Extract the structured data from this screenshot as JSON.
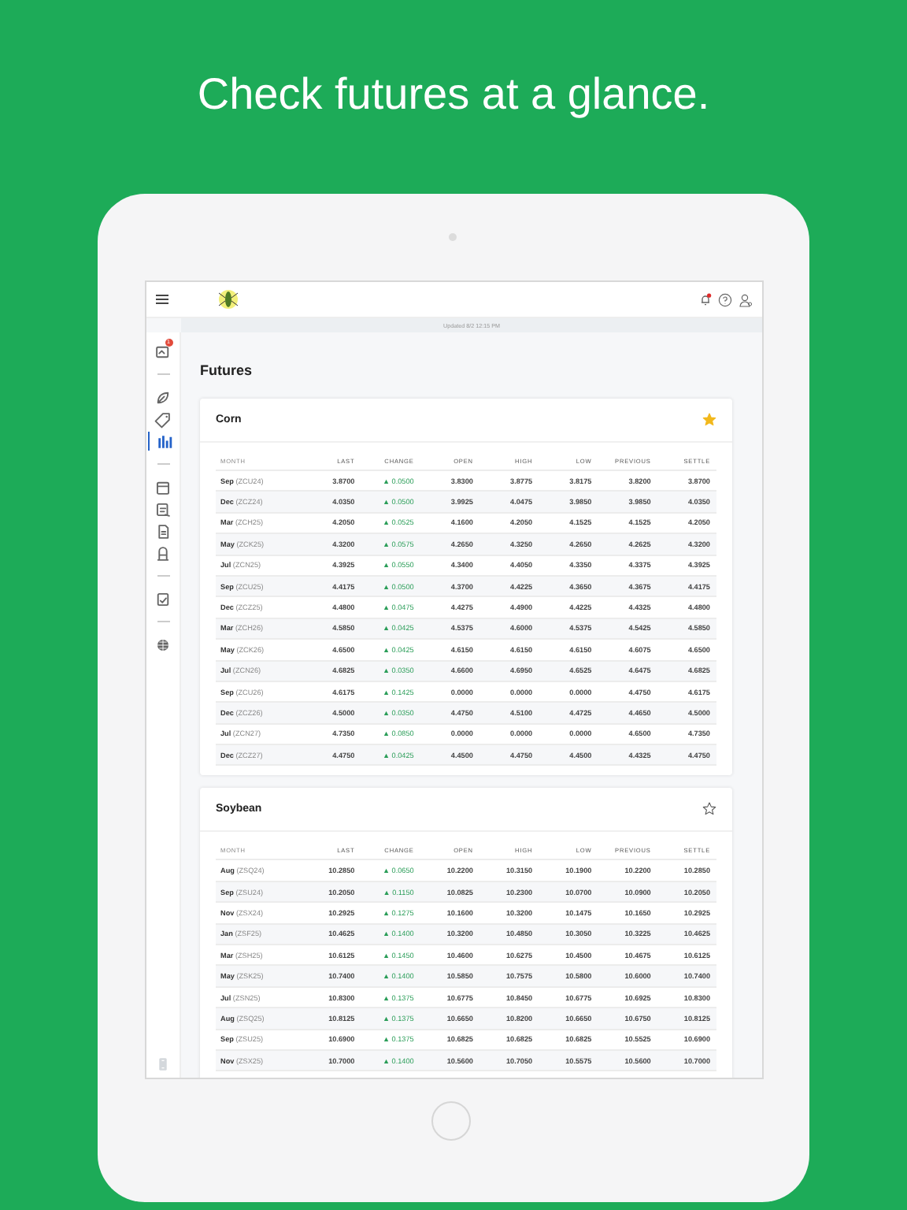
{
  "headline": "Check futures at a glance.",
  "app": {
    "status": "Updated 8/2 12:15 PM",
    "notifications_unread": true,
    "sidebar": [
      [
        {
          "selected": false,
          "badge": "1"
        }
      ],
      [
        {
          "selected": false
        },
        {
          "selected": false
        },
        {
          "selected": true
        }
      ],
      [
        {
          "selected": false
        },
        {
          "selected": false
        },
        {
          "selected": false
        },
        {
          "selected": false
        }
      ],
      [
        {
          "selected": false
        }
      ],
      [
        {
          "selected": false
        }
      ]
    ],
    "sidebar_footer": [
      {
        "selected": false
      }
    ],
    "page_title": "Futures",
    "cards": [
      {
        "title": "Corn",
        "favorite": true,
        "columns": [
          "MONTH",
          "LAST",
          "CHANGE",
          "OPEN",
          "HIGH",
          "LOW",
          "PREVIOUS",
          "SETTLE"
        ],
        "rows": [
          {
            "cells": [
              "**Sep** (ZCU24)",
              "3.8700",
              "▲ 0.0500",
              "3.8300",
              "3.8775",
              "3.8175",
              "3.8200",
              "3.8700"
            ]
          },
          {
            "cells": [
              "**Dec** (ZCZ24)",
              "4.0350",
              "▲ 0.0500",
              "3.9925",
              "4.0475",
              "3.9850",
              "3.9850",
              "4.0350"
            ]
          },
          {
            "cells": [
              "**Mar** (ZCH25)",
              "4.2050",
              "▲ 0.0525",
              "4.1600",
              "4.2050",
              "4.1525",
              "4.1525",
              "4.2050"
            ]
          },
          {
            "cells": [
              "**May** (ZCK25)",
              "4.3200",
              "▲ 0.0575",
              "4.2650",
              "4.3250",
              "4.2650",
              "4.2625",
              "4.3200"
            ]
          },
          {
            "cells": [
              "**Jul** (ZCN25)",
              "4.3925",
              "▲ 0.0550",
              "4.3400",
              "4.4050",
              "4.3350",
              "4.3375",
              "4.3925"
            ]
          },
          {
            "cells": [
              "**Sep** (ZCU25)",
              "4.4175",
              "▲ 0.0500",
              "4.3700",
              "4.4225",
              "4.3650",
              "4.3675",
              "4.4175"
            ]
          },
          {
            "cells": [
              "**Dec** (ZCZ25)",
              "4.4800",
              "▲ 0.0475",
              "4.4275",
              "4.4900",
              "4.4225",
              "4.4325",
              "4.4800"
            ]
          },
          {
            "cells": [
              "**Mar** (ZCH26)",
              "4.5850",
              "▲ 0.0425",
              "4.5375",
              "4.6000",
              "4.5375",
              "4.5425",
              "4.5850"
            ]
          },
          {
            "cells": [
              "**May** (ZCK26)",
              "4.6500",
              "▲ 0.0425",
              "4.6150",
              "4.6150",
              "4.6150",
              "4.6075",
              "4.6500"
            ]
          },
          {
            "cells": [
              "**Jul** (ZCN26)",
              "4.6825",
              "▲ 0.0350",
              "4.6600",
              "4.6950",
              "4.6525",
              "4.6475",
              "4.6825"
            ]
          },
          {
            "cells": [
              "**Sep** (ZCU26)",
              "4.6175",
              "▲ 0.1425",
              "0.0000",
              "0.0000",
              "0.0000",
              "4.4750",
              "4.6175"
            ]
          },
          {
            "cells": [
              "**Dec** (ZCZ26)",
              "4.5000",
              "▲ 0.0350",
              "4.4750",
              "4.5100",
              "4.4725",
              "4.4650",
              "4.5000"
            ]
          },
          {
            "cells": [
              "**Jul** (ZCN27)",
              "4.7350",
              "▲ 0.0850",
              "0.0000",
              "0.0000",
              "0.0000",
              "4.6500",
              "4.7350"
            ]
          },
          {
            "cells": [
              "**Dec** (ZCZ27)",
              "4.4750",
              "▲ 0.0425",
              "4.4500",
              "4.4750",
              "4.4500",
              "4.4325",
              "4.4750"
            ]
          }
        ]
      },
      {
        "title": "Soybean",
        "favorite": false,
        "columns": [
          "MONTH",
          "LAST",
          "CHANGE",
          "OPEN",
          "HIGH",
          "LOW",
          "PREVIOUS",
          "SETTLE"
        ],
        "rows": [
          {
            "cells": [
              "**Aug** (ZSQ24)",
              "10.2850",
              "▲ 0.0650",
              "10.2200",
              "10.3150",
              "10.1900",
              "10.2200",
              "10.2850"
            ]
          },
          {
            "cells": [
              "**Sep** (ZSU24)",
              "10.2050",
              "▲ 0.1150",
              "10.0825",
              "10.2300",
              "10.0700",
              "10.0900",
              "10.2050"
            ]
          },
          {
            "cells": [
              "**Nov** (ZSX24)",
              "10.2925",
              "▲ 0.1275",
              "10.1600",
              "10.3200",
              "10.1475",
              "10.1650",
              "10.2925"
            ]
          },
          {
            "cells": [
              "**Jan** (ZSF25)",
              "10.4625",
              "▲ 0.1400",
              "10.3200",
              "10.4850",
              "10.3050",
              "10.3225",
              "10.4625"
            ]
          },
          {
            "cells": [
              "**Mar** (ZSH25)",
              "10.6125",
              "▲ 0.1450",
              "10.4600",
              "10.6275",
              "10.4500",
              "10.4675",
              "10.6125"
            ]
          },
          {
            "cells": [
              "**May** (ZSK25)",
              "10.7400",
              "▲ 0.1400",
              "10.5850",
              "10.7575",
              "10.5800",
              "10.6000",
              "10.7400"
            ]
          },
          {
            "cells": [
              "**Jul** (ZSN25)",
              "10.8300",
              "▲ 0.1375",
              "10.6775",
              "10.8450",
              "10.6775",
              "10.6925",
              "10.8300"
            ]
          },
          {
            "cells": [
              "**Aug** (ZSQ25)",
              "10.8125",
              "▲ 0.1375",
              "10.6650",
              "10.8200",
              "10.6650",
              "10.6750",
              "10.8125"
            ]
          },
          {
            "cells": [
              "**Sep** (ZSU25)",
              "10.6900",
              "▲ 0.1375",
              "10.6825",
              "10.6825",
              "10.6825",
              "10.5525",
              "10.6900"
            ]
          },
          {
            "cells": [
              "**Nov** (ZSX25)",
              "10.7000",
              "▲ 0.1400",
              "10.5600",
              "10.7050",
              "10.5575",
              "10.5600",
              "10.7000"
            ]
          }
        ]
      }
    ]
  }
}
